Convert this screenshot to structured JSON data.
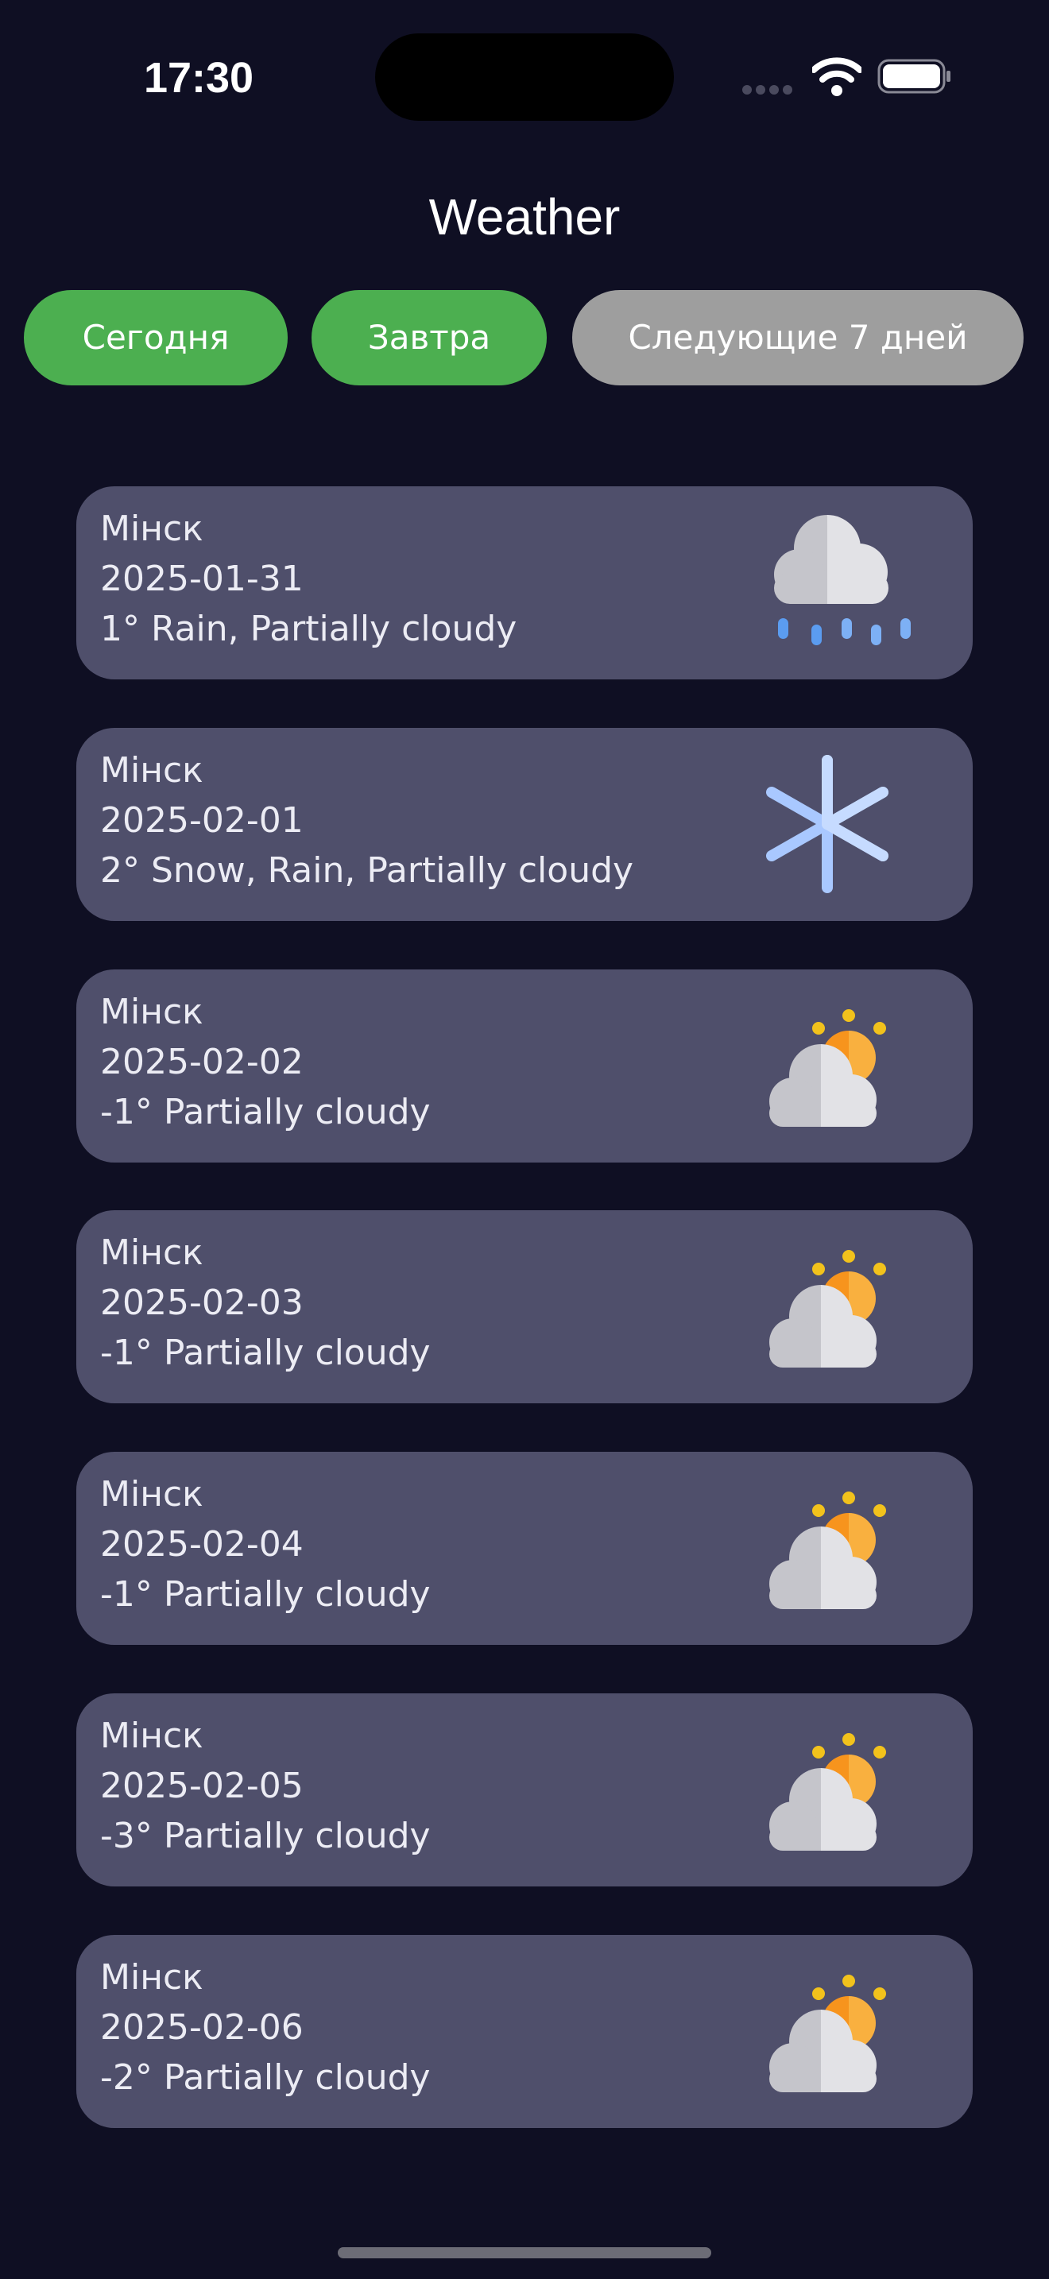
{
  "status_bar": {
    "time": "17:30",
    "icons": [
      "cellular-signal-icon",
      "wifi-icon",
      "battery-icon"
    ]
  },
  "header": {
    "title": "Weather"
  },
  "tabs": [
    {
      "label": "Сегодня",
      "active": true
    },
    {
      "label": "Завтра",
      "active": true
    },
    {
      "label": "Следующие 7 дней",
      "active": false
    }
  ],
  "colors": {
    "background": "#0f0f23",
    "card": "#4f4f6b",
    "tab_green": "#4caf50",
    "tab_gray": "#9e9e9e"
  },
  "forecast": [
    {
      "city": "Мінск",
      "date": "2025-01-31",
      "summary": "1° Rain, Partially cloudy",
      "icon": "rain-cloud-icon"
    },
    {
      "city": "Мінск",
      "date": "2025-02-01",
      "summary": "2° Snow, Rain, Partially cloudy",
      "icon": "snowflake-icon"
    },
    {
      "city": "Мінск",
      "date": "2025-02-02",
      "summary": "-1° Partially cloudy",
      "icon": "partly-cloudy-icon"
    },
    {
      "city": "Мінск",
      "date": "2025-02-03",
      "summary": "-1° Partially cloudy",
      "icon": "partly-cloudy-icon"
    },
    {
      "city": "Мінск",
      "date": "2025-02-04",
      "summary": "-1° Partially cloudy",
      "icon": "partly-cloudy-icon"
    },
    {
      "city": "Мінск",
      "date": "2025-02-05",
      "summary": "-3° Partially cloudy",
      "icon": "partly-cloudy-icon"
    },
    {
      "city": "Мінск",
      "date": "2025-02-06",
      "summary": "-2° Partially cloudy",
      "icon": "partly-cloudy-icon"
    }
  ]
}
